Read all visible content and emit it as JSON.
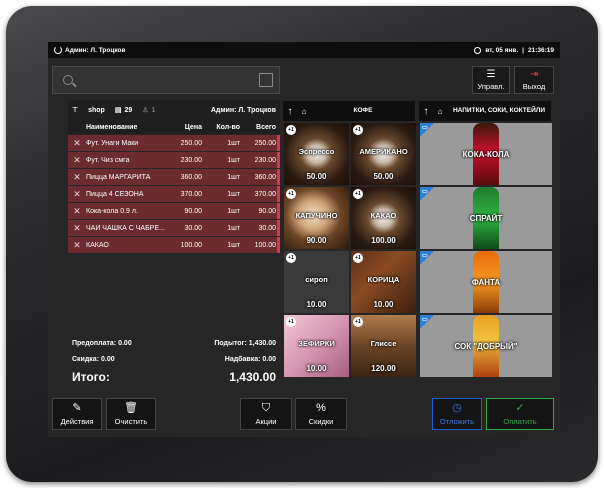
{
  "statusbar": {
    "user": "Админ: Л. Троцков",
    "date": "вт, 05 янв.",
    "time": "21:36:19"
  },
  "search": {
    "placeholder": ""
  },
  "top_buttons": {
    "manage": "Управл.",
    "exit": "Выход"
  },
  "order": {
    "shop": "shop",
    "table_number": "29",
    "guests": "1",
    "admin": "Админ: Л. Троцков",
    "columns": {
      "name": "Наименование",
      "price": "Цена",
      "qty": "Кол-во",
      "total": "Всего"
    },
    "items": [
      {
        "name": "Фут. Унаги Маки",
        "price": "250.00",
        "qty": "1шт",
        "total": "250.00"
      },
      {
        "name": "Фут. Чиз смга",
        "price": "230.00",
        "qty": "1шт",
        "total": "230.00"
      },
      {
        "name": "Пицца МАРГАРИТА",
        "price": "360.00",
        "qty": "1шт",
        "total": "360.00"
      },
      {
        "name": "Пицца 4 СЕЗОНА",
        "price": "370.00",
        "qty": "1шт",
        "total": "370.00"
      },
      {
        "name": "Кока-кола 0.9 л.",
        "price": "90.00",
        "qty": "1шт",
        "total": "90.00"
      },
      {
        "name": "ЧАЙ ЧАШКА С ЧАБРЕ...",
        "price": "30.00",
        "qty": "1шт",
        "total": "30.00"
      },
      {
        "name": "КАКАО",
        "price": "100.00",
        "qty": "1шт",
        "total": "100.00"
      }
    ],
    "prepay": "Предоплата: 0.00",
    "subtotal": "Подытог: 1,430.00",
    "discount": "Скидка: 0.00",
    "surcharge": "Надбавка: 0.00",
    "total_label": "Итого:",
    "total_value": "1,430.00"
  },
  "categories": {
    "coffee": {
      "title": "КОФЕ",
      "tiles": [
        {
          "name": "Эспрессо",
          "price": "50.00",
          "badge": "+1"
        },
        {
          "name": "АМЕРИКАНО",
          "price": "50.00",
          "badge": "+1"
        },
        {
          "name": "КАПУЧИНО",
          "price": "90.00",
          "badge": "+1"
        },
        {
          "name": "КАКАО",
          "price": "100.00",
          "badge": "+1"
        },
        {
          "name": "сироп",
          "price": "10.00",
          "badge": "+1"
        },
        {
          "name": "КОРИЦА",
          "price": "10.00",
          "badge": "+1"
        },
        {
          "name": "ЗЕФИРКИ",
          "price": "10.00",
          "badge": "+1"
        },
        {
          "name": "Глиссе",
          "price": "120.00",
          "badge": "+1"
        }
      ]
    },
    "drinks": {
      "title": "НАПИТКИ, СОКИ, КОКТЕЙЛИ",
      "tiles": [
        {
          "name": "КОКА-КОЛА"
        },
        {
          "name": "СПРАЙТ"
        },
        {
          "name": "ФАНТА"
        },
        {
          "name": "СОК \"ДОБРЫЙ\""
        }
      ]
    }
  },
  "bottom_buttons": {
    "actions": "Действия",
    "clear": "Очистить",
    "stocks": "Акции",
    "discounts": "Скидки",
    "postpone": "Отложить",
    "pay": "Оплатить"
  },
  "colors": {
    "order_row": "#6b2b2f",
    "order_row_accent": "#d23a44",
    "postpone": "#1e5fd0",
    "pay": "#2faa44",
    "folder": "#2d7fd6"
  }
}
